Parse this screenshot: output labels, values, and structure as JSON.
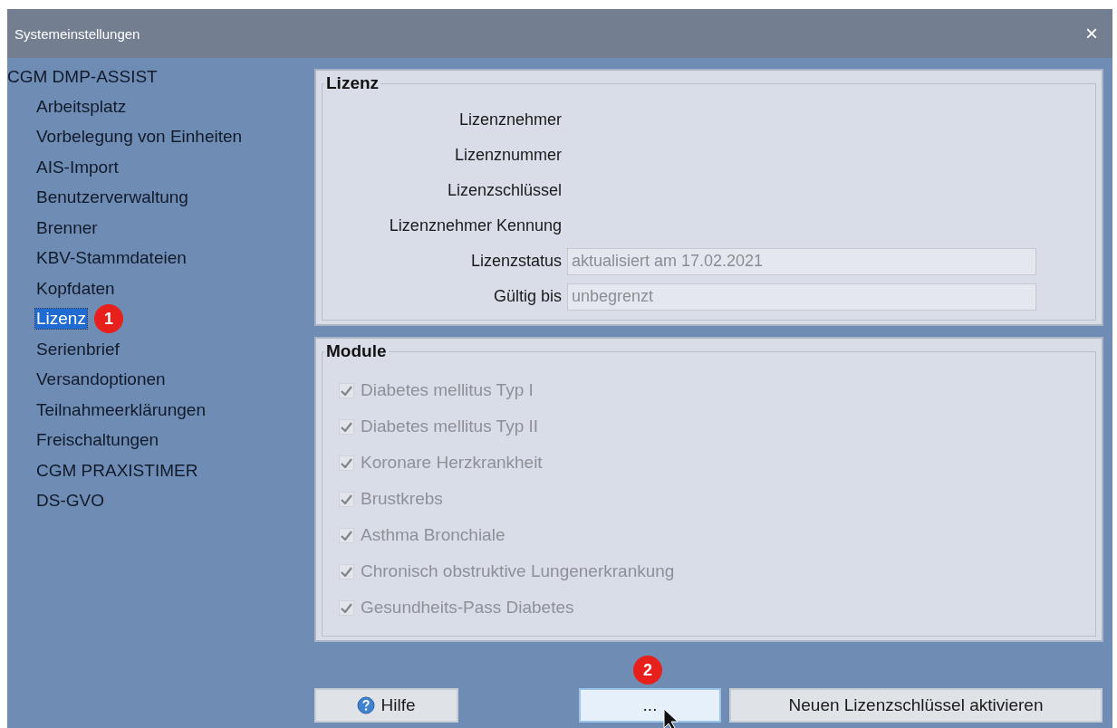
{
  "window": {
    "title": "Systemeinstellungen",
    "close": "×"
  },
  "tree": {
    "label": "CGM DMP-ASSIST",
    "children": [
      {
        "label": "Arbeitsplatz",
        "selected": false
      },
      {
        "label": "Vorbelegung von Einheiten",
        "selected": false
      },
      {
        "label": "AIS-Import",
        "selected": false
      },
      {
        "label": "Benutzerverwaltung",
        "selected": false
      },
      {
        "label": "Brenner",
        "selected": false
      },
      {
        "label": "KBV-Stammdateien",
        "selected": false
      },
      {
        "label": "Kopfdaten",
        "selected": false
      },
      {
        "label": "Lizenz",
        "selected": true,
        "badge": "1"
      },
      {
        "label": "Serienbrief",
        "selected": false
      },
      {
        "label": "Versandoptionen",
        "selected": false
      },
      {
        "label": "Teilnahmeerklärungen",
        "selected": false
      },
      {
        "label": "Freischaltungen",
        "selected": false
      },
      {
        "label": "CGM PRAXISTIMER",
        "selected": false
      },
      {
        "label": "DS-GVO",
        "selected": false
      }
    ]
  },
  "license": {
    "title": "Lizenz",
    "rows": [
      {
        "label": "Lizenznehmer",
        "kind": "text"
      },
      {
        "label": "Lizenznummer",
        "kind": "text"
      },
      {
        "label": "Lizenzschlüssel",
        "kind": "text"
      },
      {
        "label": "Lizenznehmer Kennung",
        "kind": "text"
      },
      {
        "label": "Lizenzstatus",
        "kind": "field",
        "value": "aktualisiert am 17.02.2021"
      },
      {
        "label": "Gültig bis",
        "kind": "field",
        "value": "unbegrenzt"
      }
    ]
  },
  "modules": {
    "title": "Module",
    "items": [
      {
        "label": "Diabetes mellitus Typ I",
        "checked": true,
        "disabled": true
      },
      {
        "label": "Diabetes mellitus Typ II",
        "checked": true,
        "disabled": true
      },
      {
        "label": "Koronare Herzkrankheit",
        "checked": true,
        "disabled": true
      },
      {
        "label": "Brustkrebs",
        "checked": true,
        "disabled": true
      },
      {
        "label": "Asthma Bronchiale",
        "checked": true,
        "disabled": true
      },
      {
        "label": "Chronisch obstruktive Lungenerkrankung",
        "checked": true,
        "disabled": true
      },
      {
        "label": "Gesundheits-Pass Diabetes",
        "checked": true,
        "disabled": true
      }
    ]
  },
  "buttons": [
    {
      "label": "Hilfe",
      "kind": "help",
      "focused": false
    },
    {
      "label": "...",
      "kind": "plain",
      "focused": true,
      "badge": "2"
    },
    {
      "label": "Neuen Lizenzschlüssel aktivieren",
      "kind": "plain",
      "focused": false
    }
  ]
}
